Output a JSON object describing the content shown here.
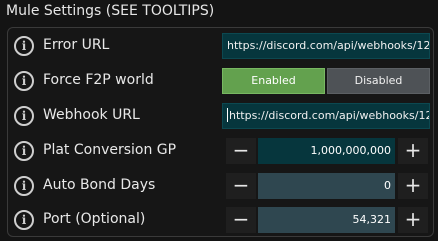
{
  "panel": {
    "title": "Mule Settings (SEE TOOLTIPS)"
  },
  "icons": {
    "info": "i"
  },
  "rows": {
    "error_url": {
      "label": "Error URL",
      "value": "https://discord.com/api/webhooks/12"
    },
    "force_f2p": {
      "label": "Force F2P world",
      "enabled_label": "Enabled",
      "disabled_label": "Disabled",
      "selected": "Enabled"
    },
    "webhook_url": {
      "label": "Webhook URL",
      "value": "https://discord.com/api/webhooks/12"
    },
    "plat_conversion": {
      "label": "Plat Conversion GP",
      "value": "1,000,000,000",
      "minus": "−",
      "plus": "+"
    },
    "auto_bond_days": {
      "label": "Auto Bond Days",
      "value": "0",
      "minus": "−",
      "plus": "+"
    },
    "port": {
      "label": "Port (Optional)",
      "value": "54,321",
      "minus": "−",
      "plus": "+"
    }
  },
  "colors": {
    "background": "#141414",
    "input_active": "#06363d",
    "input_normal": "#2f4750",
    "toggle_enabled": "#63a14e",
    "toggle_disabled": "#4e5256"
  }
}
